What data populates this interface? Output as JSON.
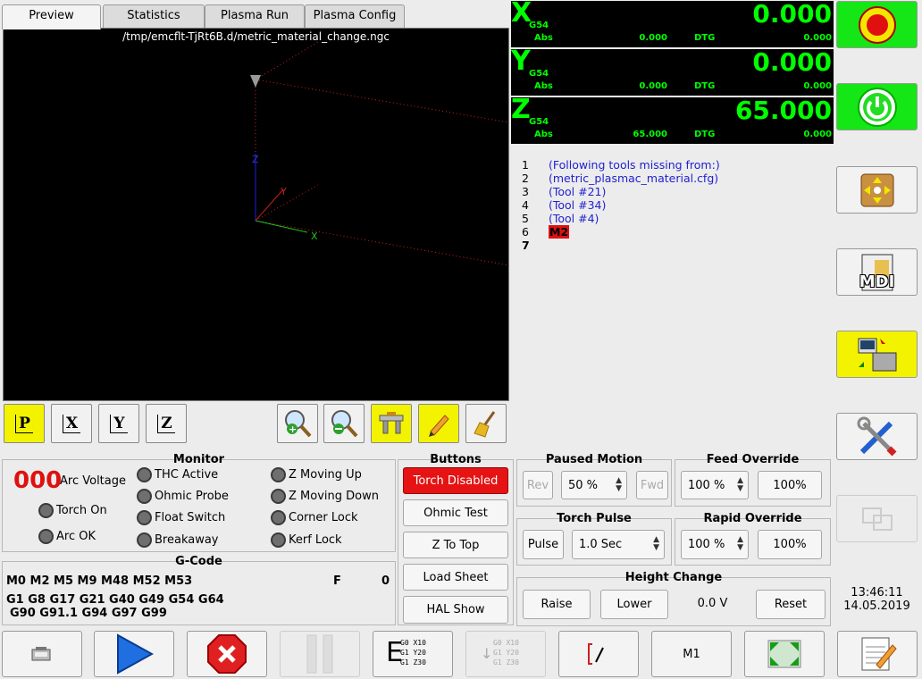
{
  "tabs": [
    "Preview",
    "Statistics",
    "Plasma Run",
    "Plasma Config"
  ],
  "preview": {
    "file_path": "/tmp/emcflt-TjRt6B.d/metric_material_change.ngc",
    "axis_labels": {
      "x": "X",
      "y": "Y",
      "z": "Z"
    }
  },
  "view_buttons": {
    "p": "P",
    "x": "X",
    "y": "Y",
    "z": "Z"
  },
  "dro": [
    {
      "axis": "X",
      "coord": "G54",
      "value": "0.000",
      "abs_label": "Abs",
      "abs": "0.000",
      "dtg_label": "DTG",
      "dtg": "0.000"
    },
    {
      "axis": "Y",
      "coord": "G54",
      "value": "0.000",
      "abs_label": "Abs",
      "abs": "0.000",
      "dtg_label": "DTG",
      "dtg": "0.000"
    },
    {
      "axis": "Z",
      "coord": "G54",
      "value": "65.000",
      "abs_label": "Abs",
      "abs": "65.000",
      "dtg_label": "DTG",
      "dtg": "0.000"
    }
  ],
  "gcode_view": [
    {
      "n": "1",
      "text": "(Following tools missing from:)"
    },
    {
      "n": "2",
      "text": "(metric_plasmac_material.cfg)"
    },
    {
      "n": "3",
      "text": "(Tool #21)"
    },
    {
      "n": "4",
      "text": "(Tool #34)"
    },
    {
      "n": "5",
      "text": "(Tool #4)"
    },
    {
      "n": "6",
      "text": "M2"
    },
    {
      "n": "7",
      "text": ""
    }
  ],
  "side": {
    "mdi_label": "MDI"
  },
  "monitor": {
    "title": "Monitor",
    "arc_value": "000",
    "arc_voltage": "Arc Voltage",
    "torch_on": "Torch On",
    "arc_ok": "Arc OK",
    "thc_active": "THC Active",
    "ohmic_probe": "Ohmic Probe",
    "float_switch": "Float Switch",
    "breakaway": "Breakaway",
    "z_moving_up": "Z Moving Up",
    "z_moving_down": "Z Moving Down",
    "corner_lock": "Corner Lock",
    "kerf_lock": "Kerf Lock"
  },
  "gcode": {
    "title": "G-Code",
    "line1": "M0 M2 M5 M9 M48 M52 M53",
    "f_label": "F",
    "f_value": "0",
    "line2": "G1 G8 G17 G21 G40 G49 G54 G64",
    "line3": "G90 G91.1 G94 G97 G99"
  },
  "buttons": {
    "title": "Buttons",
    "torch": "Torch Disabled",
    "ohmic": "Ohmic Test",
    "ztop": "Z To Top",
    "load": "Load Sheet",
    "hal": "HAL Show"
  },
  "paused": {
    "title": "Paused Motion",
    "rev": "Rev",
    "speed": "50 %",
    "fwd": "Fwd"
  },
  "feed": {
    "title": "Feed Override",
    "value": "100 %",
    "reset": "100%"
  },
  "pulse": {
    "title": "Torch Pulse",
    "button": "Pulse",
    "time": "1.0 Sec"
  },
  "rapid": {
    "title": "Rapid Override",
    "value": "100 %",
    "reset": "100%"
  },
  "height": {
    "title": "Height Change",
    "raise": "Raise",
    "lower": "Lower",
    "value": "0.0 V",
    "reset": "Reset"
  },
  "clock": {
    "time": "13:46:11",
    "date": "14.05.2019"
  },
  "bottom": {
    "g0_l1": "G0 X10",
    "g0_l2": "G1 Y20",
    "g0_l3": "G1 Z30",
    "m1": "M1"
  }
}
